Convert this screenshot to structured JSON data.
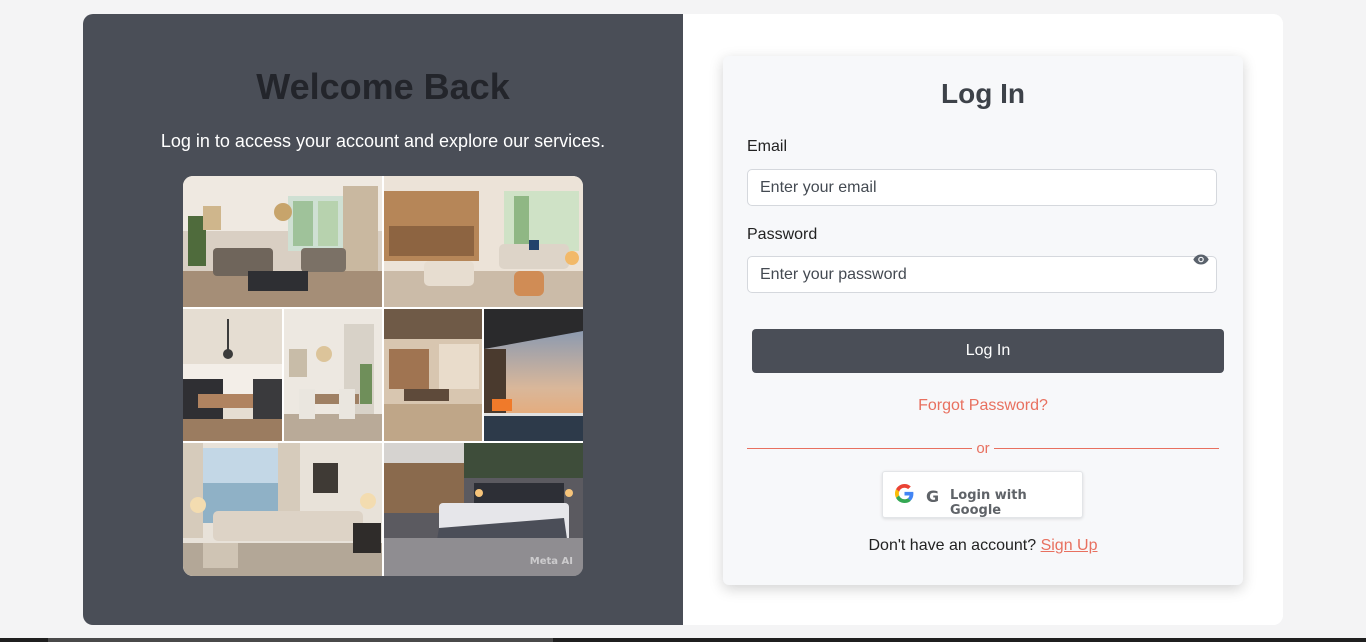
{
  "welcome": {
    "title": "Welcome Back",
    "subtitle": "Log in to access your account and explore our services.",
    "image_watermark": "Meta AI"
  },
  "login": {
    "title": "Log In",
    "email_label": "Email",
    "email_placeholder": "Enter your email",
    "password_label": "Password",
    "password_placeholder": "Enter your password",
    "submit_label": "Log In",
    "forgot_label": "Forgot Password?",
    "divider_text": "or",
    "google_label": "Login with Google",
    "google_g": "G",
    "signup_prompt": "Don't have an account?",
    "signup_label": "Sign Up"
  },
  "icons": {
    "password_toggle": "eye-icon",
    "google": "google-logo-icon"
  },
  "colors": {
    "left_panel": "#4a4e57",
    "accent": "#e8705f",
    "button": "#4a4e57",
    "title": "#3d4249"
  }
}
